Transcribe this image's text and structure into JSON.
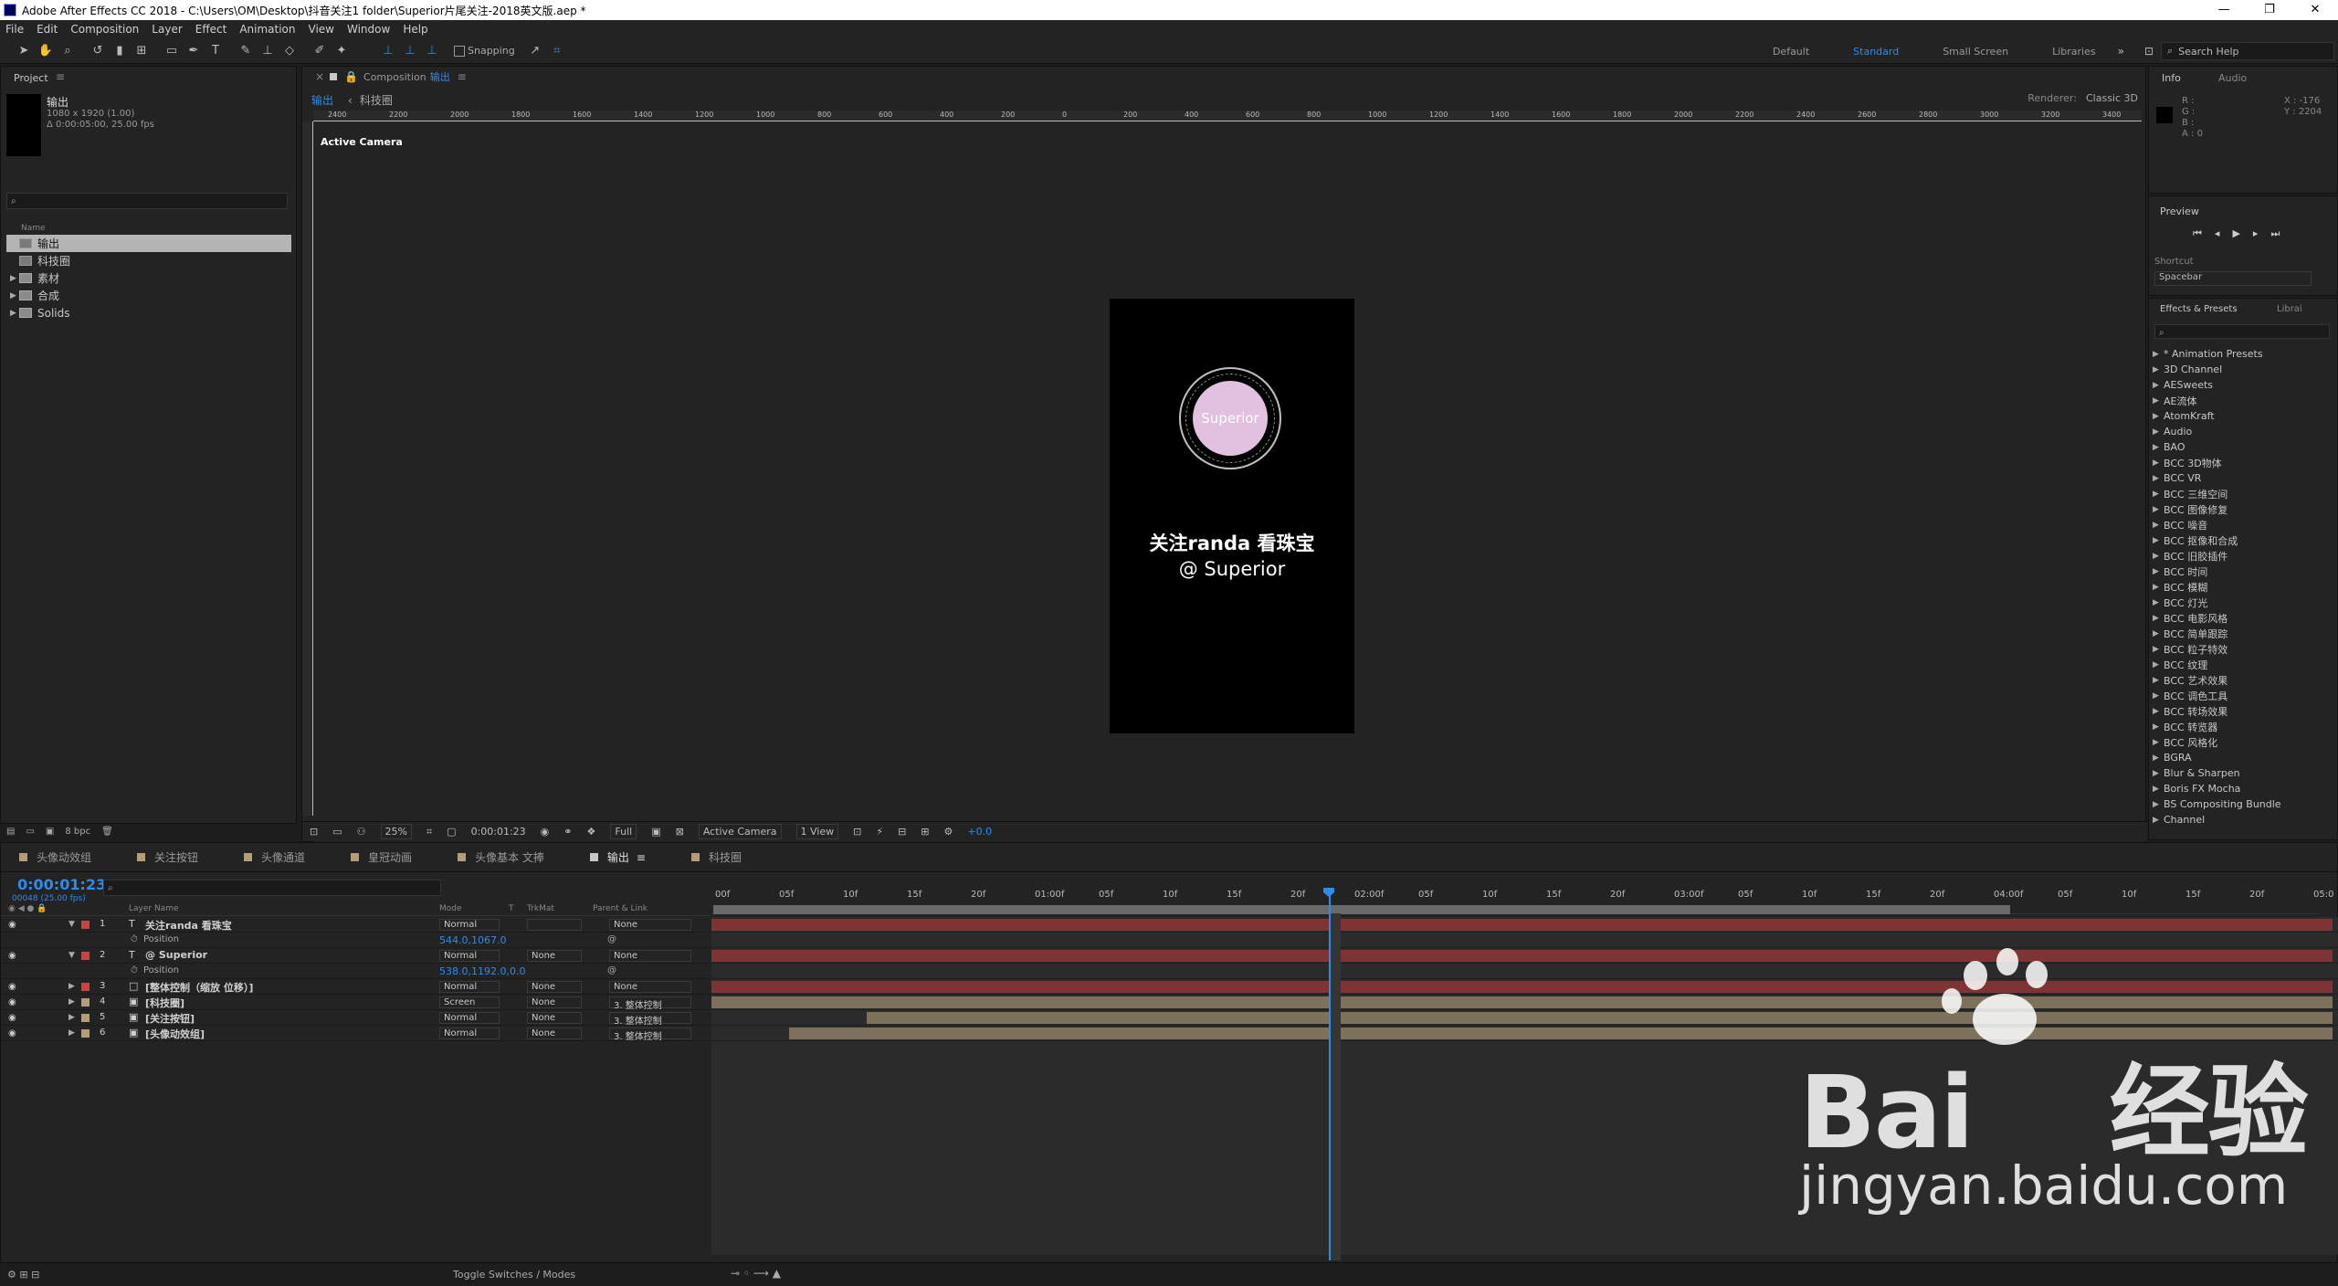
{
  "window": {
    "title": "Adobe After Effects CC 2018 - C:\\Users\\OM\\Desktop\\抖音关注1 folder\\Superior片尾关注-2018英文版.aep *",
    "controls": [
      "—",
      "❐",
      "✕"
    ]
  },
  "menu": [
    "File",
    "Edit",
    "Composition",
    "Layer",
    "Effect",
    "Animation",
    "View",
    "Window",
    "Help"
  ],
  "toolbar": {
    "snapping_label": "Snapping",
    "workspaces": [
      "Default",
      "Standard",
      "Small Screen",
      "Libraries"
    ],
    "active_workspace": "Standard",
    "search_placeholder": "Search Help"
  },
  "project": {
    "tab": "Project",
    "selected_name": "输出",
    "selected_info_1": "1080 x 1920 (1.00)",
    "selected_info_2": "Δ 0:00:05:00, 25.00 fps",
    "column_name": "Name",
    "items": [
      {
        "name": "输出",
        "kind": "comp",
        "selected": true
      },
      {
        "name": "科技圈",
        "kind": "comp"
      },
      {
        "name": "素材",
        "kind": "folder"
      },
      {
        "name": "合成",
        "kind": "folder"
      },
      {
        "name": "Solids",
        "kind": "folder"
      }
    ],
    "bpc": "8 bpc"
  },
  "composition": {
    "tab_prefix": "Composition",
    "tab_name": "输出",
    "crumbs": [
      "输出",
      "科技圈"
    ],
    "renderer_label": "Renderer:",
    "renderer": "Classic 3D",
    "active_camera_label": "Active Camera",
    "ruler_labels": [
      "2400",
      "2200",
      "2000",
      "1800",
      "1600",
      "1400",
      "1200",
      "1000",
      "800",
      "600",
      "400",
      "200",
      "0",
      "200",
      "400",
      "600",
      "800",
      "1000",
      "1200",
      "1400",
      "1600",
      "1800",
      "2000",
      "2200",
      "2400",
      "2600",
      "2800",
      "3000",
      "3200",
      "3400"
    ],
    "canvas": {
      "logo_text": "Superior",
      "line1": "关注randa  看珠宝",
      "line2": "@ Superior",
      "logo_color": "#e2c0df"
    },
    "footer": {
      "zoom": "25%",
      "time": "0:00:01:23",
      "resolution": "Full",
      "camera": "Active Camera",
      "view": "1 View",
      "exposure": "+0.0"
    }
  },
  "info_panel": {
    "tabs": [
      "Info",
      "Audio"
    ],
    "channels": [
      "R :",
      "G :",
      "B :",
      "A : 0"
    ],
    "x": "X : -176",
    "y": "Y : 2204"
  },
  "preview_panel": {
    "tab": "Preview",
    "shortcut_label": "Shortcut",
    "shortcut_value": "Spacebar"
  },
  "effects_panel": {
    "tabs": [
      "Effects & Presets",
      "Librai"
    ],
    "items": [
      "* Animation Presets",
      "3D Channel",
      "AESweets",
      "AE流体",
      "AtomKraft",
      "Audio",
      "BAO",
      "BCC 3D物体",
      "BCC VR",
      "BCC 三维空间",
      "BCC 图像修复",
      "BCC 噪音",
      "BCC 抠像和合成",
      "BCC 旧胶插件",
      "BCC 时间",
      "BCC 模糊",
      "BCC 灯光",
      "BCC 电影风格",
      "BCC 简单跟踪",
      "BCC 粒子特效",
      "BCC 纹理",
      "BCC 艺术效果",
      "BCC 调色工具",
      "BCC 转场效果",
      "BCC 转览器",
      "BCC 风格化",
      "BGRA",
      "Blur & Sharpen",
      "Boris FX Mocha",
      "BS Compositing Bundle",
      "Channel"
    ]
  },
  "timeline": {
    "tabs": [
      {
        "name": "头像动效组",
        "color": "#b59e77"
      },
      {
        "name": "关注按钮",
        "color": "#b59e77"
      },
      {
        "name": "头像通道",
        "color": "#b59e77"
      },
      {
        "name": "皇冠动画",
        "color": "#b59e77"
      },
      {
        "name": "头像基本 文捧",
        "color": "#b59e77"
      },
      {
        "name": "输出",
        "color": "#c8c8c8",
        "active": true
      },
      {
        "name": "科技圈",
        "color": "#b59e77"
      }
    ],
    "timecode": "0:00:01:23",
    "frames": "00048 (25.00 fps)",
    "headers": {
      "layer_name": "Layer Name",
      "mode": "Mode",
      "t": "T",
      "trkmat": "TrkMat",
      "parent": "Parent & Link"
    },
    "ruler": [
      "00f",
      "05f",
      "10f",
      "15f",
      "20f",
      "01:00f",
      "05f",
      "10f",
      "15f",
      "20f",
      "02:00f",
      "05f",
      "10f",
      "15f",
      "20f",
      "03:00f",
      "05f",
      "10f",
      "15f",
      "20f",
      "04:00f",
      "05f",
      "10f",
      "15f",
      "20f",
      "05:0"
    ],
    "playhead_time_s": 1.92,
    "duration_s": 5,
    "layers": [
      {
        "num": "1",
        "type": "T",
        "name": "关注randa  看珠宝",
        "label": "#d04040",
        "mode": "Normal",
        "trkmat": "",
        "parent": "None",
        "expanded": true,
        "bar": "#7e3434",
        "start": 0,
        "end": 5
      },
      {
        "sub": true,
        "prop": "Position",
        "value": "544.0,1067.0"
      },
      {
        "num": "2",
        "type": "T",
        "name": "@ Superior",
        "label": "#d04040",
        "mode": "Normal",
        "trkmat": "None",
        "parent": "None",
        "expanded": true,
        "bar": "#7e3434",
        "start": 0,
        "end": 5
      },
      {
        "sub": true,
        "prop": "Position",
        "value": "538.0,1192.0,0.0"
      },
      {
        "num": "3",
        "type": "□",
        "name": "[整体控制（缩放 位移）]",
        "label": "#d04040",
        "mode": "Normal",
        "trkmat": "None",
        "parent": "None",
        "bar": "#7e3434",
        "start": 0,
        "end": 5
      },
      {
        "num": "4",
        "type": "▣",
        "name": "[科技圈]",
        "label": "#b59e77",
        "mode": "Screen",
        "trkmat": "None",
        "parent": "3. 整体控制",
        "bar": "#7d715c",
        "start": 0,
        "end": 5
      },
      {
        "num": "5",
        "type": "▣",
        "name": "[关注按钮]",
        "label": "#b59e77",
        "mode": "Normal",
        "trkmat": "None",
        "parent": "3. 整体控制",
        "bar": "#7d715c",
        "start": 0.48,
        "end": 5
      },
      {
        "num": "6",
        "type": "▣",
        "name": "[头像动效组]",
        "label": "#b59e77",
        "mode": "Normal",
        "trkmat": "None",
        "parent": "3. 整体控制",
        "bar": "#7d715c",
        "start": 0.24,
        "end": 5
      }
    ],
    "toggle_label": "Toggle Switches / Modes"
  },
  "watermark": {
    "brand": "Bai",
    "brand2": "经验",
    "url": "jingyan.baidu.com"
  }
}
